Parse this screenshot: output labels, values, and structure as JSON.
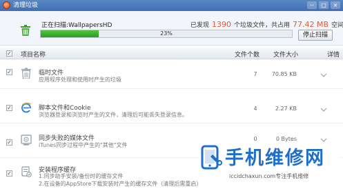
{
  "window": {
    "title": "清理垃圾",
    "controls": [
      "－",
      "□",
      "×"
    ]
  },
  "scan": {
    "status_prefix": "正在扫描:",
    "status_target": "WallpapersHD",
    "found_prefix": "已发现",
    "found_count": "1390",
    "found_mid": "个垃圾文件，共占用",
    "found_size": "77.42 MB",
    "found_suffix": "空间",
    "progress_fraction": 0.23,
    "progress_label": "23%",
    "stop_button": "停止扫描"
  },
  "columns": {
    "name": "项目名称",
    "count": "文件个数",
    "size": "文件大小",
    "detail": "详情"
  },
  "rows": [
    {
      "icon": "trash-icon",
      "name": "临时文件",
      "desc": "应用程序处理和使用时产生的垃圾",
      "count": "7",
      "size": "70.85 KB",
      "checked": true
    },
    {
      "icon": "ie-browser-icon",
      "name": "脚本文件和Cookie",
      "desc": "浏览器登录和浏览时产生的文件，清理后可能丢失登录信息。",
      "count": "4",
      "size": "2.27 KB",
      "checked": true
    },
    {
      "icon": "media-sync-icon",
      "name": "同步失败的媒体文件",
      "desc": "iTunes同步过程中产生的\"其他\"文件",
      "count": "0",
      "size": "0 Bytes",
      "checked": true
    },
    {
      "icon": "app-cache-icon",
      "name": "安装程序缓存",
      "desc": "1.同步助手安装/备份时的缓存文件",
      "desc2": "2.在设备的AppStore下载安装时产生的缓存文件（清理后需重启）",
      "count": "",
      "size": "",
      "checked": true
    }
  ],
  "watermark": {
    "title": "手机维修网",
    "url": "iccidchaxun.com专注手机维修"
  },
  "colors": {
    "titlebar": "#3f6fb4",
    "progress": "#2d9c22",
    "accent_number": "#e2583a",
    "watermark_blue": "#1f6fc8"
  }
}
